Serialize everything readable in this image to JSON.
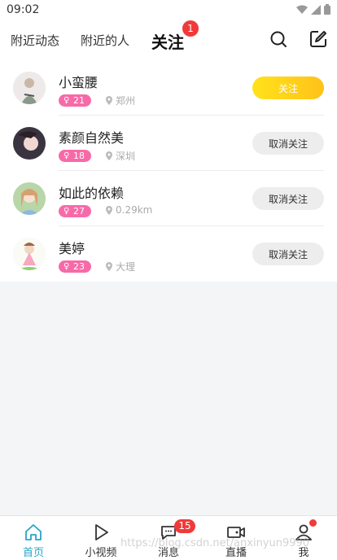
{
  "status_bar": {
    "time": "09:02"
  },
  "top_nav": {
    "tabs": [
      "附近动态",
      "附近的人",
      "关注"
    ],
    "active_tab": "关注",
    "follow_badge": "1",
    "icons": [
      "search-icon",
      "edit-icon"
    ]
  },
  "users": [
    {
      "name": "小蛮腰",
      "age": "21",
      "location": "郑州",
      "button": "关注",
      "followed": false
    },
    {
      "name": "素颜自然美",
      "age": "18",
      "location": "深圳",
      "button": "取消关注",
      "followed": true
    },
    {
      "name": "如此的依赖",
      "age": "27",
      "location": "0.29km",
      "button": "取消关注",
      "followed": true
    },
    {
      "name": "美婷",
      "age": "23",
      "location": "大理",
      "button": "取消关注",
      "followed": true
    }
  ],
  "bottom_nav": {
    "items": [
      "首页",
      "小视频",
      "消息",
      "直播",
      "我"
    ],
    "active": "首页",
    "message_badge": "15",
    "icons": [
      "home-icon",
      "play-icon",
      "chat-icon",
      "video-camera-icon",
      "user-icon"
    ]
  },
  "watermark": "https://blog.csdn.net/anxinyun9990",
  "colors": {
    "accent_yellow": "#ffd21b",
    "tag_pink": "#f76aa8",
    "badge_red": "#f03a3a",
    "active_blue": "#27a5c5",
    "background": "#f4f5f7"
  }
}
